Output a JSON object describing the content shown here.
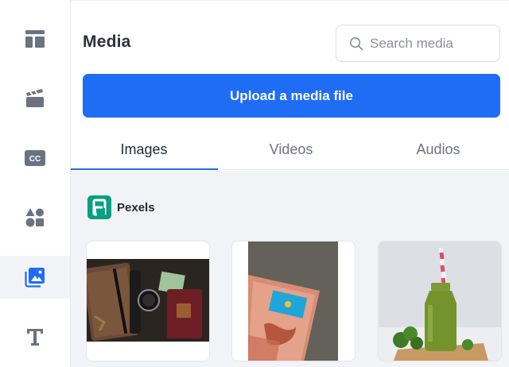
{
  "sidebar": {
    "items": [
      {
        "icon": "layout-icon"
      },
      {
        "icon": "clapperboard-icon"
      },
      {
        "icon": "closed-captions-icon",
        "label": "CC"
      },
      {
        "icon": "shapes-icon"
      },
      {
        "icon": "image-icon",
        "active": true
      },
      {
        "icon": "text-icon"
      }
    ]
  },
  "header": {
    "title": "Media",
    "search_placeholder": "Search media"
  },
  "upload_label": "Upload a media file",
  "tabs": [
    {
      "label": "Images",
      "active": true
    },
    {
      "label": "Videos"
    },
    {
      "label": "Audios"
    }
  ],
  "provider": {
    "name": "Pexels",
    "logo_letter": "P"
  },
  "images": [
    {
      "subject": "watch-pen-passport-photo"
    },
    {
      "subject": "flag-banknote-photo"
    },
    {
      "subject": "green-smoothie-bottle-photo"
    }
  ],
  "colors": {
    "accent": "#1f6cf5",
    "icon_gray": "#6b7280",
    "active_icon": "#1f6cf5",
    "pexels_green": "#07a081",
    "panel_background": "#f2f3f6"
  }
}
